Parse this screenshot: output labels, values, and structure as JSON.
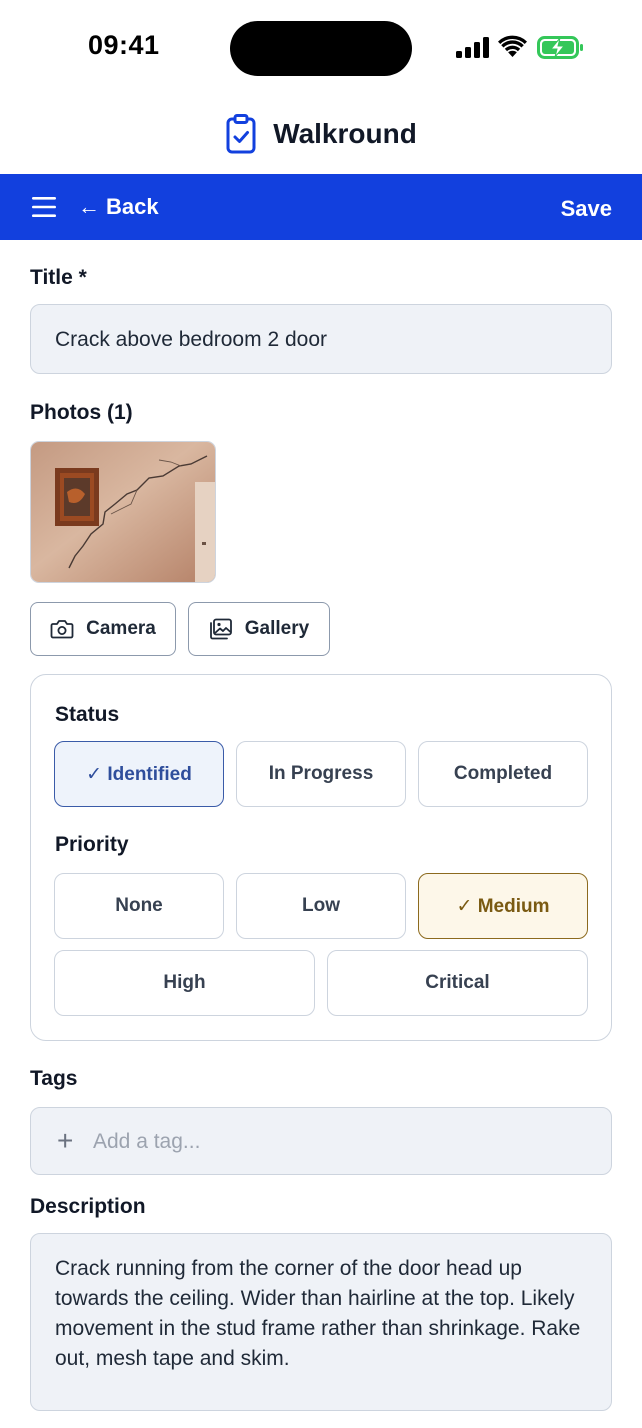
{
  "status_bar": {
    "time": "09:41"
  },
  "app": {
    "title": "Walkround",
    "icon": "clipboard-check-icon"
  },
  "navbar": {
    "back_label": "Back",
    "back_arrow": "←",
    "save_label": "Save",
    "background": "#1240DE"
  },
  "form": {
    "title_label": "Title *",
    "title_value": "Crack above bedroom 2 door",
    "photos_label": "Photos (1)",
    "camera_label": "Camera",
    "gallery_label": "Gallery",
    "status_label": "Status",
    "status_options": [
      "✓ Identified",
      "In Progress",
      "Completed"
    ],
    "priority_label": "Priority",
    "priority_options": [
      "None",
      "Low",
      "✓ Medium",
      "High",
      "Critical"
    ],
    "tags_label": "Tags",
    "tags_placeholder": "Add a tag...",
    "description_label": "Description",
    "description_value": "Crack running from the corner of the door head up towards the ceiling. Wider than hairline at the top. Likely movement in the stud frame rather than shrinkage. Rake out, mesh tape and skim."
  },
  "colors": {
    "selected_status": "#2F4E9C",
    "selected_priority": "#7A5A12",
    "field_bg": "#EFF2F7"
  }
}
